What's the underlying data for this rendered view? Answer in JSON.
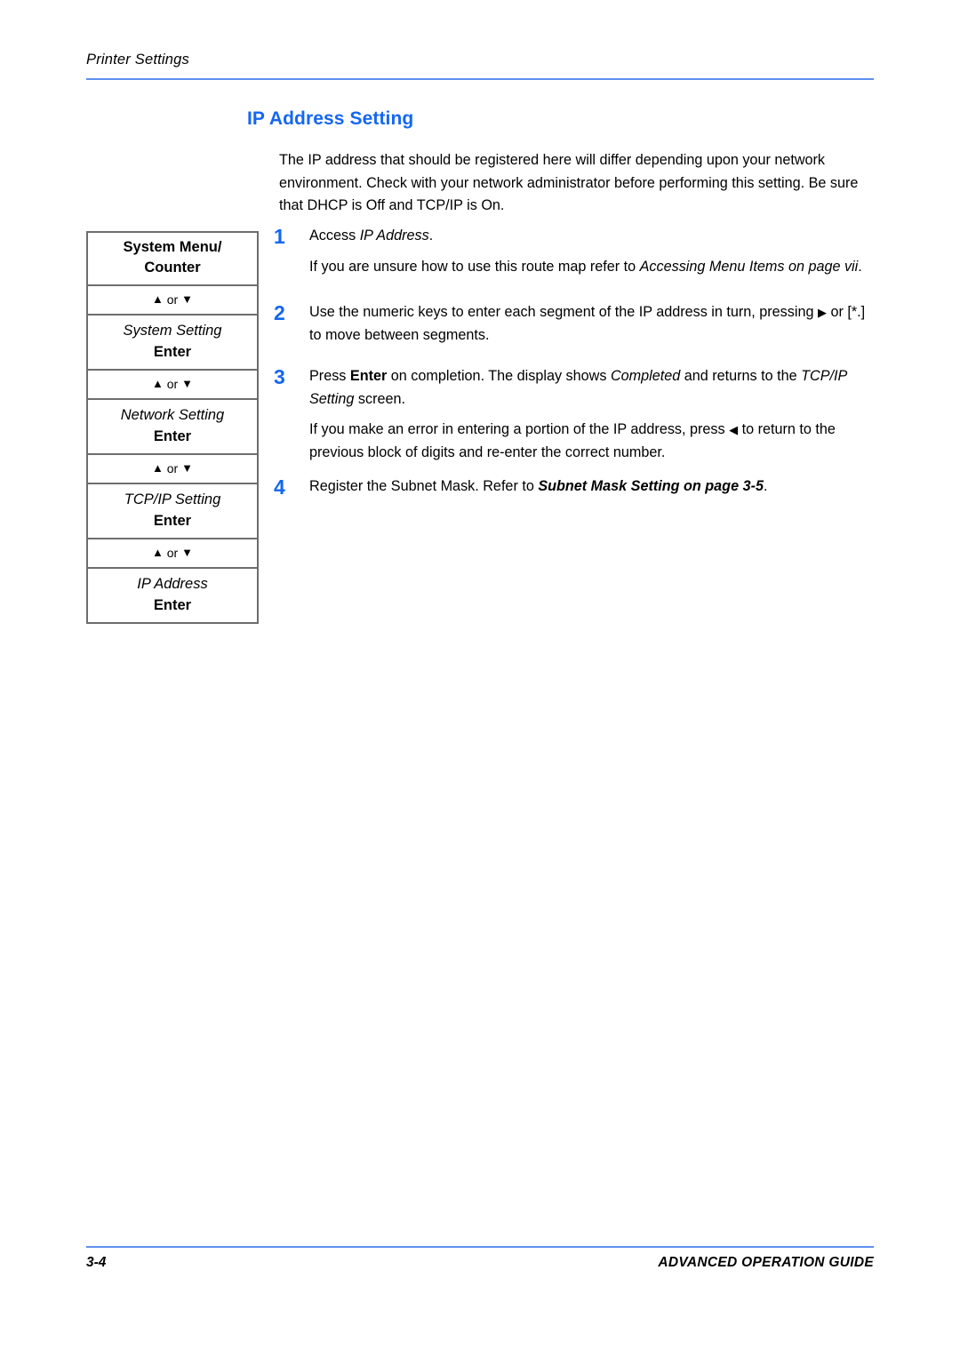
{
  "header": {
    "running_title": "Printer Settings",
    "rule_color": "#5e8ff0"
  },
  "section": {
    "title": "IP Address Setting",
    "title_color": "#1467f0"
  },
  "intro": {
    "text": "The IP address that should be registered here will differ depending upon your network environment. Check with your network administrator before performing this setting. Be sure that DHCP is Off and TCP/IP is On."
  },
  "route_map": {
    "rows": [
      {
        "type": "menu",
        "label": "System Menu/\nCounter",
        "style": "bold"
      },
      {
        "type": "keys",
        "label": "▲ or ▼"
      },
      {
        "type": "menu",
        "label": "System Setting",
        "style": "italic",
        "action": "Enter"
      },
      {
        "type": "keys",
        "label": "▲ or ▼"
      },
      {
        "type": "menu",
        "label": "Network Setting",
        "style": "italic",
        "action": "Enter"
      },
      {
        "type": "keys",
        "label": "▲ or ▼"
      },
      {
        "type": "menu",
        "label": "TCP/IP Setting",
        "style": "italic",
        "action": "Enter"
      },
      {
        "type": "keys",
        "label": "▲ or ▼"
      },
      {
        "type": "menu",
        "label": "IP Address",
        "style": "italic",
        "action": "Enter"
      }
    ],
    "row1_line1": "System Menu/",
    "row1_line2": "Counter",
    "keys_up": "▲",
    "keys_or": "or",
    "keys_down": "▼",
    "row3_label": "System Setting",
    "row5_label": "Network Setting",
    "row7_label": "TCP/IP Setting",
    "row9_label": "IP Address",
    "enter_label": "Enter"
  },
  "steps": [
    {
      "number": "1",
      "paragraphs": [
        {
          "pre": "Access ",
          "italic": "IP Address",
          "post": "."
        },
        {
          "pre": "If you are unsure how to use this route map refer to ",
          "italic": "Accessing Menu Items on page vii",
          "post": "."
        }
      ]
    },
    {
      "number": "2",
      "paragraphs": [
        {
          "pre": "Use the numeric keys to enter each segment of the IP address in turn, pressing ",
          "glyph": "▶",
          "mid": " or [*.] to move between segments.",
          "post": ""
        }
      ]
    },
    {
      "number": "3",
      "paragraphs": [
        {
          "pre": "Press ",
          "bold": "Enter",
          "mid": " on completion. The display shows ",
          "italic": "Completed",
          "mid2": " and returns to the ",
          "italic2": "TCP/IP Setting",
          "post": " screen."
        },
        {
          "pre": "If you make an error in entering a portion of the IP address, press ",
          "glyph": "◀",
          "mid": " to return to the previous block of digits and re-enter the correct number.",
          "post": ""
        }
      ]
    },
    {
      "number": "4",
      "paragraphs": [
        {
          "pre": "Register the Subnet Mask. Refer to ",
          "bold_italic": "Subnet Mask Setting on page 3-5",
          "post": "."
        }
      ]
    }
  ],
  "footer": {
    "page_number": "3-4",
    "guide_title": "ADVANCED OPERATION GUIDE"
  }
}
